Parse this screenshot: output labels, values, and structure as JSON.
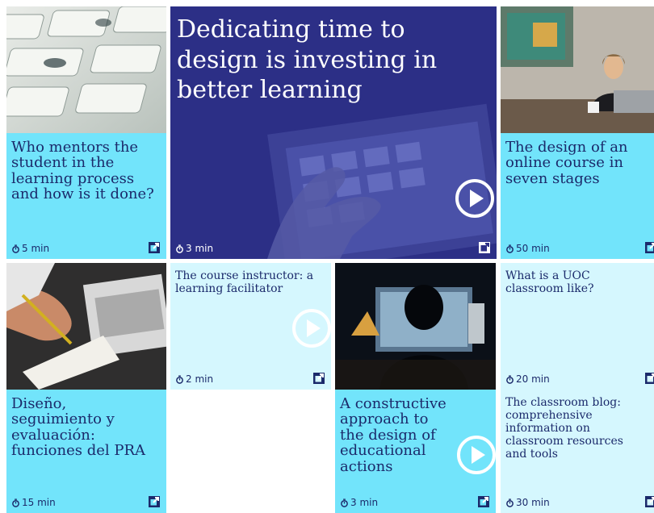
{
  "tiles": [
    {
      "title": "Who mentors the student in the learning process and how is it done?",
      "time": "5 min"
    },
    {
      "title": "Dedicating time to design is investing in better learning",
      "time": "3 min"
    },
    {
      "title": "The design of an online course in seven stages",
      "time": "50 min"
    },
    {
      "title": "The course instructor: a learning facilitator",
      "time": "2 min"
    },
    {
      "title": "What is a UOC classroom like?",
      "time": "20 min"
    },
    {
      "title": "Diseño, seguimiento y evaluación: funciones del PRA",
      "time": "15 min"
    },
    {
      "title": "A constructive approach to the design of educational actions",
      "time": "3 min"
    },
    {
      "title": "The classroom blog: comprehensive information on classroom resources and tools",
      "time": "30 min"
    }
  ],
  "colors": {
    "cyan": "#72e4fb",
    "pale": "#d5f7fe",
    "navy": "#2c2f86",
    "text": "#1b2a6b"
  },
  "icons": {
    "time": "stopwatch-icon",
    "link": "external-link-icon",
    "video": "play-icon"
  }
}
